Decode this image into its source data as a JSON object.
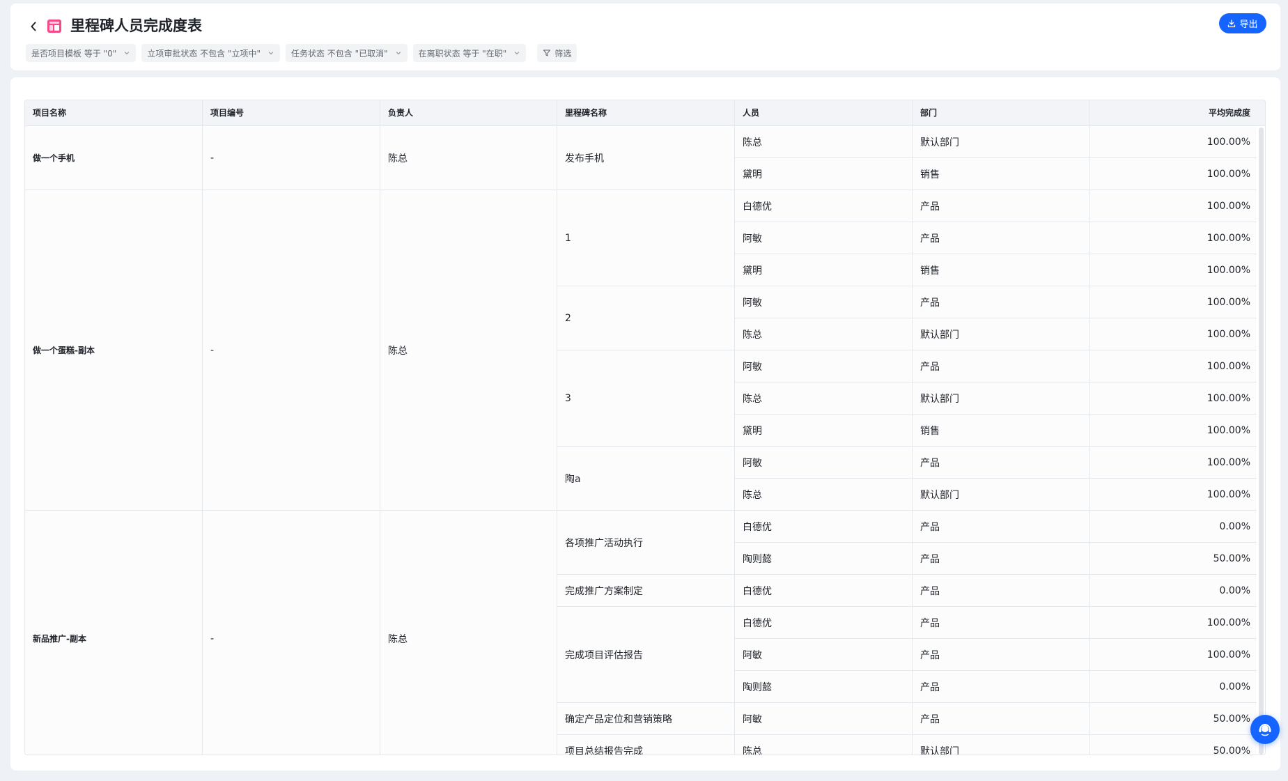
{
  "header": {
    "title": "里程碑人员完成度表",
    "export_label": "导出",
    "filters": [
      {
        "label": "是否项目模板 等于 \"0\""
      },
      {
        "label": "立项审批状态 不包含 \"立项中\""
      },
      {
        "label": "任务状态 不包含 \"已取消\""
      },
      {
        "label": "在离职状态 等于 \"在职\""
      }
    ],
    "filter_button_label": "筛选"
  },
  "colors": {
    "accent": "#1664ff",
    "icon_pink": "#f54a8a",
    "header_bg": "#f2f4f8",
    "border": "#e4e7ec"
  },
  "table": {
    "columns": [
      "项目名称",
      "项目编号",
      "负责人",
      "里程碑名称",
      "人员",
      "部门",
      "平均完成度"
    ],
    "projects": [
      {
        "name": "做一个手机",
        "code": "-",
        "owner": "陈总",
        "milestones": [
          {
            "name": "发布手机",
            "people": [
              {
                "person": "陈总",
                "dept": "默认部门",
                "completion": "100.00%"
              },
              {
                "person": "黛明",
                "dept": "销售",
                "completion": "100.00%"
              }
            ]
          }
        ]
      },
      {
        "name": "做一个蛋糕-副本",
        "code": "-",
        "owner": "陈总",
        "milestones": [
          {
            "name": "1",
            "people": [
              {
                "person": "白德优",
                "dept": "产品",
                "completion": "100.00%"
              },
              {
                "person": "阿敏",
                "dept": "产品",
                "completion": "100.00%"
              },
              {
                "person": "黛明",
                "dept": "销售",
                "completion": "100.00%"
              }
            ]
          },
          {
            "name": "2",
            "people": [
              {
                "person": "阿敏",
                "dept": "产品",
                "completion": "100.00%"
              },
              {
                "person": "陈总",
                "dept": "默认部门",
                "completion": "100.00%"
              }
            ]
          },
          {
            "name": "3",
            "people": [
              {
                "person": "阿敏",
                "dept": "产品",
                "completion": "100.00%"
              },
              {
                "person": "陈总",
                "dept": "默认部门",
                "completion": "100.00%"
              },
              {
                "person": "黛明",
                "dept": "销售",
                "completion": "100.00%"
              }
            ]
          },
          {
            "name": "陶a",
            "people": [
              {
                "person": "阿敏",
                "dept": "产品",
                "completion": "100.00%"
              },
              {
                "person": "陈总",
                "dept": "默认部门",
                "completion": "100.00%"
              }
            ]
          }
        ]
      },
      {
        "name": "新品推广-副本",
        "code": "-",
        "owner": "陈总",
        "milestones": [
          {
            "name": "各项推广活动执行",
            "people": [
              {
                "person": "白德优",
                "dept": "产品",
                "completion": "0.00%"
              },
              {
                "person": "陶则懿",
                "dept": "产品",
                "completion": "50.00%"
              }
            ]
          },
          {
            "name": "完成推广方案制定",
            "people": [
              {
                "person": "白德优",
                "dept": "产品",
                "completion": "0.00%"
              }
            ]
          },
          {
            "name": "完成项目评估报告",
            "people": [
              {
                "person": "白德优",
                "dept": "产品",
                "completion": "100.00%"
              },
              {
                "person": "阿敏",
                "dept": "产品",
                "completion": "100.00%"
              },
              {
                "person": "陶则懿",
                "dept": "产品",
                "completion": "0.00%"
              }
            ]
          },
          {
            "name": "确定产品定位和营销策略",
            "people": [
              {
                "person": "阿敏",
                "dept": "产品",
                "completion": "50.00%"
              }
            ]
          },
          {
            "name": "项目总结报告完成",
            "people": [
              {
                "person": "陈总",
                "dept": "默认部门",
                "completion": "50.00%"
              }
            ]
          }
        ]
      }
    ]
  }
}
